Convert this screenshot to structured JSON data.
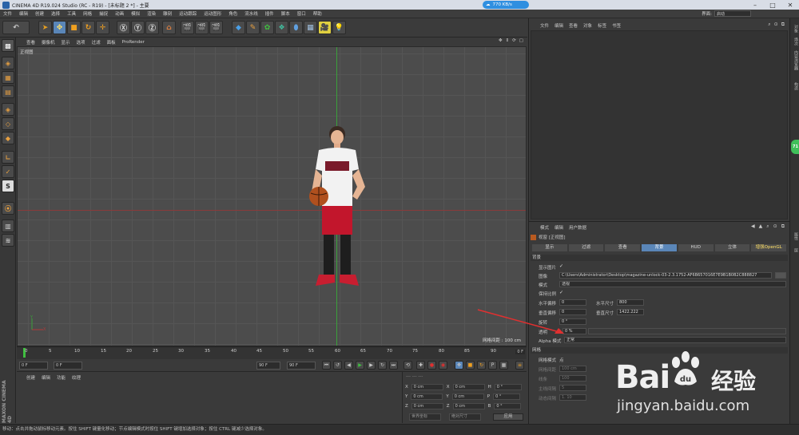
{
  "titlebar": {
    "title": "CINEMA 4D R19.024 Studio (RC - R19) - [未标题 2 *] - 主要",
    "net_speed": "770 KB/s"
  },
  "menubar": {
    "items": [
      "文件",
      "编辑",
      "创建",
      "选择",
      "工具",
      "网格",
      "捕捉",
      "动画",
      "模拟",
      "渲染",
      "雕刻",
      "运动跟踪",
      "运动图形",
      "角色",
      "流水线",
      "插件",
      "脚本",
      "窗口",
      "帮助"
    ],
    "interface_label": "界面:",
    "interface_value": "启动"
  },
  "viewport": {
    "menu": [
      "查看",
      "摄像机",
      "显示",
      "选项",
      "过滤",
      "面板",
      "ProRender"
    ],
    "label": "正视图",
    "grid_info": "网格间距 : 100 cm"
  },
  "timeline": {
    "ticks": [
      "0",
      "5",
      "10",
      "15",
      "20",
      "25",
      "30",
      "35",
      "40",
      "45",
      "50",
      "55",
      "60",
      "65",
      "70",
      "75",
      "80",
      "85",
      "90"
    ],
    "end_frame": "0 F"
  },
  "transport": {
    "current_frame": "0 F",
    "start_frame": "0 F",
    "end_frame_a": "90 F",
    "end_frame_b": "90 F"
  },
  "material_panel": {
    "tabs": [
      "创建",
      "编辑",
      "功能",
      "纹理"
    ],
    "logo": "MAXON CINEMA 4D"
  },
  "coord_panel": {
    "header": "--- --- ---",
    "rows": [
      {
        "a": "X",
        "av": "0 cm",
        "b": "X",
        "bv": "0 cm",
        "c": "H",
        "cv": "0 °"
      },
      {
        "a": "Y",
        "av": "0 cm",
        "b": "Y",
        "bv": "0 cm",
        "c": "P",
        "cv": "0 °"
      },
      {
        "a": "Z",
        "av": "0 cm",
        "b": "Z",
        "bv": "0 cm",
        "c": "B",
        "cv": "0 °"
      }
    ],
    "dropdown1": "世界坐标",
    "dropdown2": "绝对尺寸",
    "apply": "应用"
  },
  "status": "移动：点击并拖动鼠标移动元素。按住 SHIFT 键量化移动；节点编辑模式时按住 SHIFT 键增加选择对象；按住 CTRL 键减少选择对象。",
  "object_panel": {
    "menu": [
      "文件",
      "编辑",
      "查看",
      "对象",
      "标签",
      "书签"
    ]
  },
  "right_edge": {
    "tabs": [
      "对象",
      "场次",
      "内容浏览器",
      "构造",
      "属性",
      "层"
    ],
    "bubble": "71"
  },
  "attr_panel": {
    "menu": [
      "模式",
      "编辑",
      "用户数据"
    ],
    "object_title": "视窗 [正视图]",
    "tabs": [
      "显示",
      "过滤",
      "查看",
      "背景",
      "HUD",
      "立体",
      "增强OpenGL"
    ],
    "active_tab": "背景",
    "section_bg": "背景",
    "show_image_label": "显示图片",
    "image_label": "图像",
    "image_path": "C:\\Users\\Administrator\\Desktop\\magazine-unlock-03-2.3.1752-AF6B657016E7E9B1B0B2C888827",
    "mode_label": "模式",
    "mode_value": "透视",
    "keep_ratio_label": "保持比例",
    "h_offset_label": "水平偏移",
    "h_offset_value": "0",
    "h_size_label": "水平尺寸",
    "h_size_value": "800",
    "v_offset_label": "垂直偏移",
    "v_offset_value": "0",
    "v_size_label": "垂直尺寸",
    "v_size_value": "1422.222",
    "rotate_label": "旋转",
    "rotate_value": "0 °",
    "transparency_label": "透明",
    "transparency_value": "0 %",
    "alpha_label": "Alpha 模式",
    "alpha_value": "正常",
    "section_grid": "网格",
    "grid_mode_label": "网格模式",
    "grid_mode_value": "点",
    "grid_spacing_label": "网格间距",
    "grid_spacing_value": "100 cm",
    "lines_label": "线条",
    "lines_value": "100",
    "major_label": "主线间隔",
    "major_value": "5",
    "dynamic_label": "动态间隔",
    "dynamic_value": "1. 10"
  },
  "watermark": {
    "bai": "Bai",
    "du": "du",
    "cn": "经验",
    "url": "jingyan.baidu.com"
  }
}
